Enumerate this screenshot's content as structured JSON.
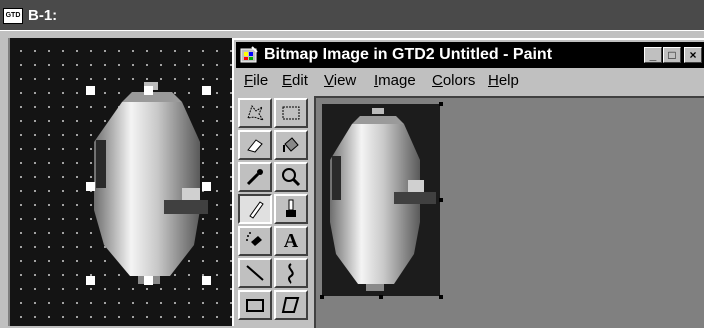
{
  "outer_window": {
    "title": "B-1:",
    "icon_text": "GTD"
  },
  "paint": {
    "title": "Bitmap Image in GTD2 Untitled - Paint",
    "buttons": {
      "minimize": "_",
      "maximize": "□",
      "close": "×"
    },
    "menu": [
      {
        "label": "File",
        "accel": "F",
        "rest": "ile"
      },
      {
        "label": "Edit",
        "accel": "E",
        "rest": "dit"
      },
      {
        "label": "View",
        "accel": "V",
        "rest": "iew"
      },
      {
        "label": "Image",
        "accel": "I",
        "rest": "mage"
      },
      {
        "label": "Colors",
        "accel": "C",
        "rest": "olors"
      },
      {
        "label": "Help",
        "accel": "H",
        "rest": "elp"
      }
    ],
    "tools": [
      "free-form-select-icon",
      "select-icon",
      "eraser-icon",
      "fill-icon",
      "color-picker-icon",
      "magnifier-icon",
      "pencil-icon",
      "brush-icon",
      "airbrush-icon",
      "text-icon",
      "line-icon",
      "curve-icon",
      "rectangle-icon",
      "polygon-icon"
    ],
    "selected_tool": "pencil-icon",
    "text_tool_label": "A"
  },
  "colors": {
    "title_bar": "#000000",
    "outer_title": "#4a4a4a",
    "canvas_bg": "#141414",
    "workspace": "#808080"
  }
}
